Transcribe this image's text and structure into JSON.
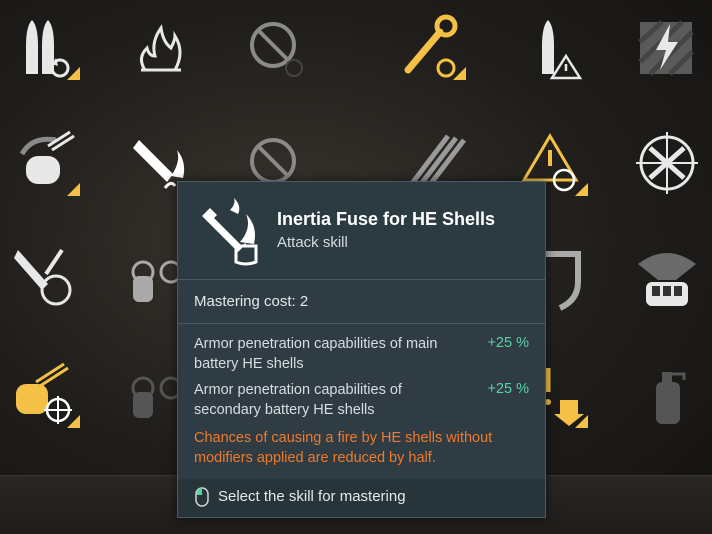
{
  "skill_grid": [
    {
      "id": "ammo-reload",
      "icon": "shells-reload-icon",
      "state": "available",
      "corner": true
    },
    {
      "id": "fire",
      "icon": "fire-icon",
      "state": "available",
      "corner": false
    },
    {
      "id": "prohibited-1",
      "icon": "no-entry-icon",
      "state": "dimmed",
      "corner": false
    },
    {
      "id": "wrench",
      "icon": "wrench-reload-icon",
      "state": "learned",
      "corner": true
    },
    {
      "id": "shell-warning",
      "icon": "shell-warning-icon",
      "state": "available",
      "corner": false
    },
    {
      "id": "lightning",
      "icon": "lightning-icon",
      "state": "dimmed",
      "corner": false
    }
  ],
  "colors": {
    "gold": "#f5c046",
    "white_icon": "#e8e8e8",
    "dim_icon": "#6e6e6e",
    "bonus_green": "#58d3a4",
    "penalty_orange": "#f07a2b"
  },
  "tooltip": {
    "icon": "he-shell-fire-icon",
    "title": "Inertia Fuse for HE Shells",
    "subtitle": "Attack skill",
    "mastering_cost": "Mastering cost: 2",
    "effects": [
      {
        "label": "Armor penetration capabilities of main battery HE shells",
        "value": "+25 %"
      },
      {
        "label": "Armor penetration capabilities of secondary battery HE shells",
        "value": "+25 %"
      }
    ],
    "penalty": "Chances of causing a fire by HE shells without modifiers applied are reduced by half.",
    "footer": "Select the skill for mastering",
    "footer_icon": "mouse-icon"
  }
}
